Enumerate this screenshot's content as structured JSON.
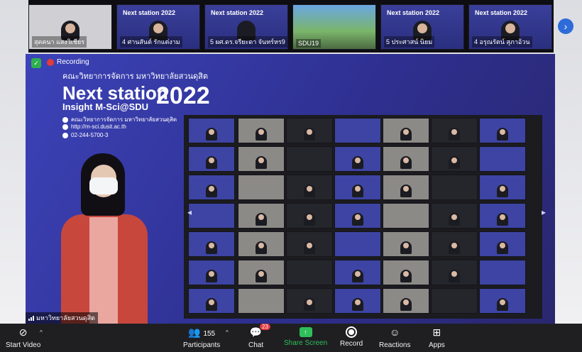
{
  "top_strip": {
    "tiles": [
      {
        "name": "สุดคนา แสงวิเชียร",
        "mini": ""
      },
      {
        "name": "4 ศานสันต์ รักแต่งาม",
        "mini": "Next station 2022"
      },
      {
        "name": "5 ผศ.ดร.จรียะดา จันทร์หร9",
        "mini": "Next station 2022"
      },
      {
        "name": "SDU19",
        "mini": ""
      },
      {
        "name": "5 ประศาสน์ นิยม",
        "mini": "Next station 2022"
      },
      {
        "name": "4 อรุณรัตน์ สุภาอ้วน",
        "mini": "Next station 2022"
      }
    ]
  },
  "stage": {
    "recording_label": "Recording",
    "faculty_thai": "คณะวิทยาการจัดการ มหาวิทยาลัยสวนดุสิต",
    "event_title": "Next station",
    "event_year": "2022",
    "event_sub": "Insight M-Sci@SDU",
    "contact_fb": "คณะวิทยาการจัดการ มหาวิทยาลัยสวนดุสิต",
    "contact_web": "http://m-sci.dusit.ac.th",
    "contact_phone": "02-244-5700-3",
    "presenter_label": "มหาวิทยาลัยสวนดุสิต"
  },
  "toolbar": {
    "start_video": "Start Video",
    "participants": "Participants",
    "participants_count": "155",
    "chat": "Chat",
    "chat_badge": "23",
    "share_screen": "Share Screen",
    "record": "Record",
    "reactions": "Reactions",
    "apps": "Apps"
  },
  "colors": {
    "stage_bg": "#2e2f8f",
    "share_green": "#2fbf5a",
    "record_red": "#e23b3b",
    "toolbar_bg": "#1f1f22"
  },
  "icons": [
    "shield-icon",
    "recording-icon",
    "next-page-icon",
    "video-off-icon",
    "participants-icon",
    "chat-icon",
    "share-screen-icon",
    "record-icon",
    "reactions-icon",
    "apps-icon"
  ]
}
